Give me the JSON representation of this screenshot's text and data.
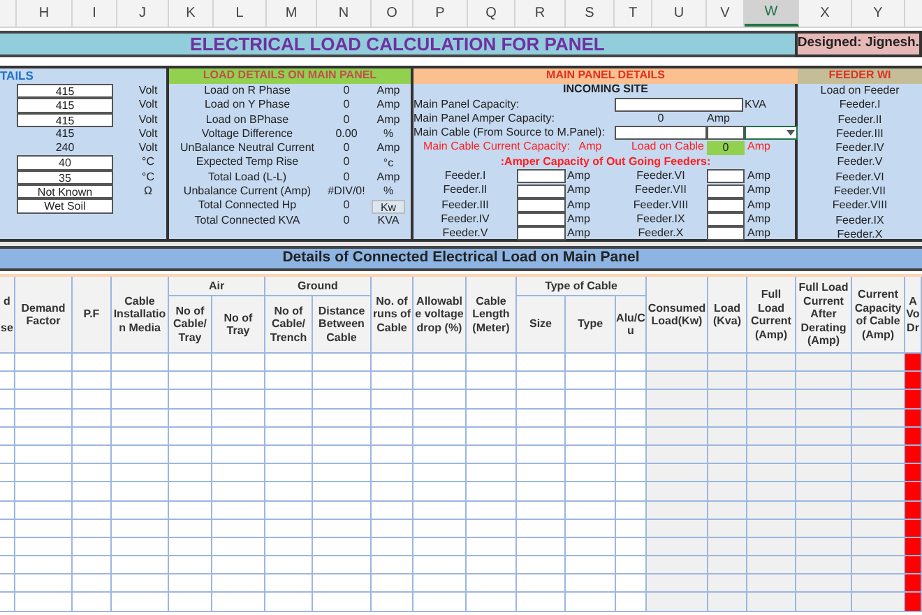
{
  "column_headers": [
    {
      "label": "H",
      "selected": false
    },
    {
      "label": "I",
      "selected": false
    },
    {
      "label": "J",
      "selected": false
    },
    {
      "label": "K",
      "selected": false
    },
    {
      "label": "L",
      "selected": false
    },
    {
      "label": "M",
      "selected": false
    },
    {
      "label": "N",
      "selected": false
    },
    {
      "label": "O",
      "selected": false
    },
    {
      "label": "P",
      "selected": false
    },
    {
      "label": "Q",
      "selected": false
    },
    {
      "label": "R",
      "selected": false
    },
    {
      "label": "S",
      "selected": false
    },
    {
      "label": "T",
      "selected": false
    },
    {
      "label": "U",
      "selected": false
    },
    {
      "label": "V",
      "selected": false
    },
    {
      "label": "W",
      "selected": true
    },
    {
      "label": "X",
      "selected": false
    },
    {
      "label": "Y",
      "selected": false
    }
  ],
  "title": "ELECTRICAL LOAD CALCULATION FOR PANEL",
  "designer": "Designed: Jignesh.",
  "details_panel": {
    "title": "TAILS",
    "rows": [
      {
        "value": "415",
        "boxed": true,
        "unit": "Volt"
      },
      {
        "value": "415",
        "boxed": true,
        "unit": "Volt"
      },
      {
        "value": "415",
        "boxed": true,
        "unit": "Volt"
      },
      {
        "value": "415",
        "boxed": false,
        "unit": "Volt"
      },
      {
        "value": "240",
        "boxed": false,
        "unit": "Volt"
      },
      {
        "value": "40",
        "boxed": true,
        "unit": "°C"
      },
      {
        "value": "35",
        "boxed": true,
        "unit": "°C"
      },
      {
        "value": "Not Known",
        "boxed": true,
        "unit": "Ω"
      },
      {
        "value": "Wet Soil",
        "boxed": true
      }
    ]
  },
  "load_panel": {
    "title": "LOAD DETAILS ON MAIN PANEL",
    "rows": [
      {
        "label": "Load on R Phase",
        "value": "0",
        "unit": "Amp",
        "boxed": false
      },
      {
        "label": "Load on Y Phase",
        "value": "0",
        "unit": "Amp",
        "boxed": false
      },
      {
        "label": "Load on BPhase",
        "value": "0",
        "unit": "Amp",
        "boxed": false
      },
      {
        "label": "Voltage Difference",
        "value": "0.00",
        "unit": "%",
        "boxed": false
      },
      {
        "label": "UnBalance Neutral Current",
        "value": "0",
        "unit": "Amp",
        "boxed": false
      },
      {
        "label": "Expected Temp Rise",
        "value": "0",
        "unit": "°c",
        "boxed": false
      },
      {
        "label": "Total Load (L-L)",
        "value": "0",
        "unit": "Amp",
        "boxed": false
      },
      {
        "label": "Unbalance Current (Amp)",
        "value": "#DIV/0!",
        "unit": "%",
        "boxed": false
      },
      {
        "label": "Total Connected Hp",
        "value": "0",
        "unit": "Kw",
        "boxed": true
      },
      {
        "label": "Total Connected KVA",
        "value": "0",
        "unit": "KVA",
        "boxed": false
      }
    ]
  },
  "main_panel": {
    "title": "MAIN PANEL DETAILS",
    "subtitle": "INCOMING SITE",
    "capacity": {
      "label": "Main Panel Capacity:",
      "unit": "KVA"
    },
    "amper_capacity": {
      "label": "Main Panel Amper Capacity:",
      "value": "0",
      "unit": "Amp"
    },
    "main_cable": {
      "label": "Main Cable (From Source to M.Panel):"
    },
    "current_capacity": {
      "label": "Main Cable Current Capacity:",
      "unit": "Amp",
      "load_label": "Load on Cable",
      "load_value": "0",
      "load_unit": "Amp"
    },
    "feeders_title": ":Amper Capacity of Out Going Feeders:",
    "feeders": [
      {
        "label": "Feeder.I",
        "unit": "Amp"
      },
      {
        "label": "Feeder.II",
        "unit": "Amp"
      },
      {
        "label": "Feeder.III",
        "unit": "Amp"
      },
      {
        "label": "Feeder.IV",
        "unit": "Amp"
      },
      {
        "label": "Feeder.V",
        "unit": "Amp"
      },
      {
        "label": "Feeder.VI",
        "unit": "Amp"
      },
      {
        "label": "Feeder.VII",
        "unit": "Amp"
      },
      {
        "label": "Feeder.VIII",
        "unit": "Amp"
      },
      {
        "label": "Feeder.IX",
        "unit": "Amp"
      },
      {
        "label": "Feeder.X",
        "unit": "Amp"
      }
    ]
  },
  "feeder_panel": {
    "title": "FEEDER WI",
    "header": "Load on Feeder",
    "feeders": [
      "Feeder.I",
      "Feeder.II",
      "Feeder.III",
      "Feeder.IV",
      "Feeder.V",
      "Feeder.VI",
      "Feeder.VII",
      "Feeder.VIII",
      "Feeder.IX",
      "Feeder.X"
    ]
  },
  "table": {
    "title": "Details of Connected Electrical Load on Main Panel",
    "columns": [
      {
        "label": "d\n\nse",
        "kind": "input"
      },
      {
        "label": "Demand Factor",
        "kind": "input"
      },
      {
        "label": "P.F",
        "kind": "input"
      },
      {
        "label": "Cable Installation Media",
        "kind": "input"
      },
      {
        "label": "Air",
        "children": [
          {
            "label": "No of Cable/ Tray",
            "kind": "input"
          },
          {
            "label": "No of Tray",
            "kind": "input"
          }
        ]
      },
      {
        "label": "Ground",
        "children": [
          {
            "label": "No of Cable/ Trench",
            "kind": "input"
          },
          {
            "label": "Distance Between Cable",
            "kind": "input"
          }
        ]
      },
      {
        "label": "No. of runs of Cable",
        "kind": "input"
      },
      {
        "label": "Allowable voltage drop (%)",
        "kind": "input"
      },
      {
        "label": "Cable Length (Meter)",
        "kind": "input"
      },
      {
        "label": "Type of Cable",
        "children": [
          {
            "label": "Size",
            "kind": "input"
          },
          {
            "label": "Type",
            "kind": "input"
          },
          {
            "label": "Alu/Cu",
            "kind": "input"
          }
        ]
      },
      {
        "label": "Consumed Load(Kw)",
        "kind": "computed"
      },
      {
        "label": "Load (Kva)",
        "kind": "computed"
      },
      {
        "label": "Full Load Current (Amp)",
        "kind": "computed"
      },
      {
        "label": "Full Load Current After Derating (Amp)",
        "kind": "computed"
      },
      {
        "label": "Current Capacity of Cable (Amp)",
        "kind": "computed"
      },
      {
        "label": "A\nVo\nDr",
        "kind": "alert"
      }
    ]
  }
}
